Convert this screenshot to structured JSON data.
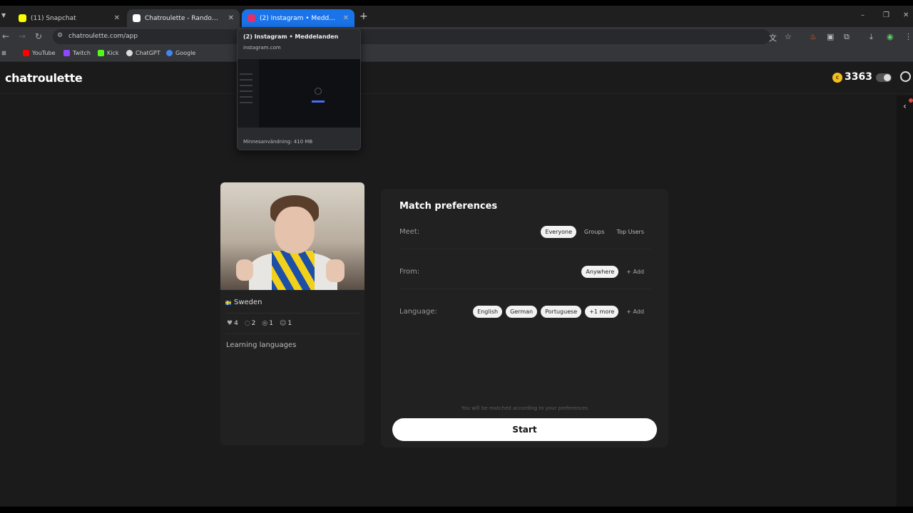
{
  "browser": {
    "tabs": [
      {
        "title": "(11) Snapchat",
        "color": "#fffc00"
      },
      {
        "title": "Chatroulette - Random video c",
        "color": "#ffffff"
      },
      {
        "title": "(2) Instagram • Meddelanden",
        "color": "#e1306c"
      }
    ],
    "url": "chatroulette.com/app",
    "bookmarks": [
      {
        "label": "YouTube",
        "color": "#ff0000"
      },
      {
        "label": "Twitch",
        "color": "#9146ff"
      },
      {
        "label": "Kick",
        "color": "#53fc18"
      },
      {
        "label": "ChatGPT",
        "color": "#dddddd"
      },
      {
        "label": "Google",
        "color": "#4285f4"
      }
    ],
    "hover_card": {
      "title": "(2) Instagram • Meddelanden",
      "domain": "instagram.com",
      "memory": "Minnesanvändning: 410 MB"
    }
  },
  "app": {
    "logo": "chatroulette",
    "coins": "3363"
  },
  "profile": {
    "country": "Sweden",
    "stats": [
      "4",
      "2",
      "1",
      "1"
    ],
    "bio": "Learning languages"
  },
  "prefs": {
    "title": "Match preferences",
    "meet_label": "Meet:",
    "meet_options": [
      "Everyone",
      "Groups",
      "Top Users"
    ],
    "from_label": "From:",
    "from_value": "Anywhere",
    "add_label": "+ Add",
    "language_label": "Language:",
    "languages": [
      "English",
      "German",
      "Portuguese",
      "+1 more"
    ],
    "hint": "You will be matched according to your preferences",
    "start": "Start"
  }
}
